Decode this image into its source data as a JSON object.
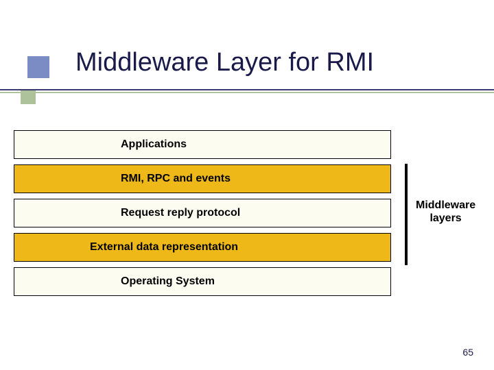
{
  "title": "Middleware Layer for RMI",
  "layers": {
    "applications": "Applications",
    "rmi_rpc": "RMI, RPC and events",
    "request_reply": "Request reply protocol",
    "external_data": "External data representation",
    "os": "Operating System"
  },
  "label": {
    "middleware_line1": "Middleware",
    "middleware_line2": "layers"
  },
  "page_number": "65"
}
